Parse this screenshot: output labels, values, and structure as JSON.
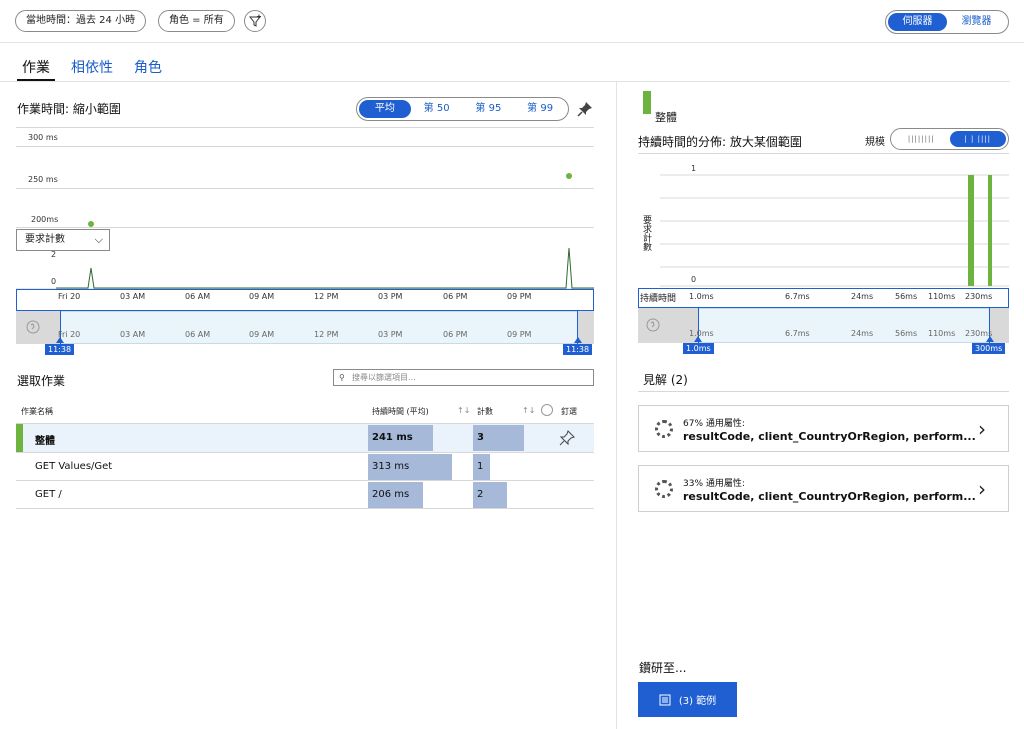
{
  "filters": {
    "time_range": "當地時間：過去 24 小時",
    "role": "角色 = 所有"
  },
  "view_toggle": {
    "server": "伺服器",
    "browser": "瀏覽器",
    "selected": "server"
  },
  "tabs": [
    {
      "label": "作業",
      "active": true
    },
    {
      "label": "相依性",
      "active": false
    },
    {
      "label": "角色",
      "active": false
    }
  ],
  "operation_times": {
    "title": "作業時間: 縮小範圍",
    "percentiles": [
      "平均",
      "第 50",
      "第 95",
      "第 99"
    ],
    "selected_percentile": "平均",
    "y_labels": [
      "300 ms",
      "250 ms",
      "200ms"
    ],
    "count_labels": [
      "2",
      "0"
    ],
    "metric_dropdown": "要求計數",
    "time_ticks": [
      "Fri 20",
      "03 AM",
      "06 AM",
      "09 AM",
      "12 PM",
      "03 PM",
      "06 PM",
      "09 PM"
    ],
    "brush_start": "11:38",
    "brush_end": "11:38"
  },
  "select_operation": {
    "title": "選取作業",
    "search_placeholder": "搜尋以篩選項目...",
    "columns": {
      "name": "作業名稱",
      "duration": "持續時間 (平均)",
      "count": "計數",
      "pin": "釘選"
    },
    "rows": [
      {
        "name": "整體",
        "duration": "241 ms",
        "duration_value": 241,
        "count": "3",
        "count_value": 3,
        "selected": true
      },
      {
        "name": "GET Values/Get",
        "duration": "313 ms",
        "duration_value": 313,
        "count": "1",
        "count_value": 1,
        "selected": false
      },
      {
        "name": "GET /",
        "duration": "206 ms",
        "duration_value": 206,
        "count": "2",
        "count_value": 2,
        "selected": false
      }
    ]
  },
  "distribution": {
    "legend_label": "整體",
    "title": "持續時間的分佈: 放大某個範圍",
    "scale_label": "規模",
    "y_axis_label": "要求計數",
    "y_ticks": [
      "1",
      "0"
    ],
    "x_axis_label": "持續時間",
    "x_ticks": [
      "1.0ms",
      "6.7ms",
      "24ms",
      "56ms",
      "110ms",
      "230ms"
    ],
    "brush_start": "1.0ms",
    "brush_end": "300ms"
  },
  "insights": {
    "title": "見解 (2)",
    "cards": [
      {
        "percent": "67% 通用屬性:",
        "properties": "resultCode, client_CountryOrRegion, perform..."
      },
      {
        "percent": "33% 通用屬性:",
        "properties": "resultCode, client_CountryOrRegion, perform..."
      }
    ]
  },
  "drill_into": {
    "title": "鑽研至...",
    "samples_button": "(3) 範例"
  },
  "colors": {
    "accent": "#1f5fd1",
    "series_green": "#6db33f",
    "bar_fill": "#a6b9d9"
  }
}
